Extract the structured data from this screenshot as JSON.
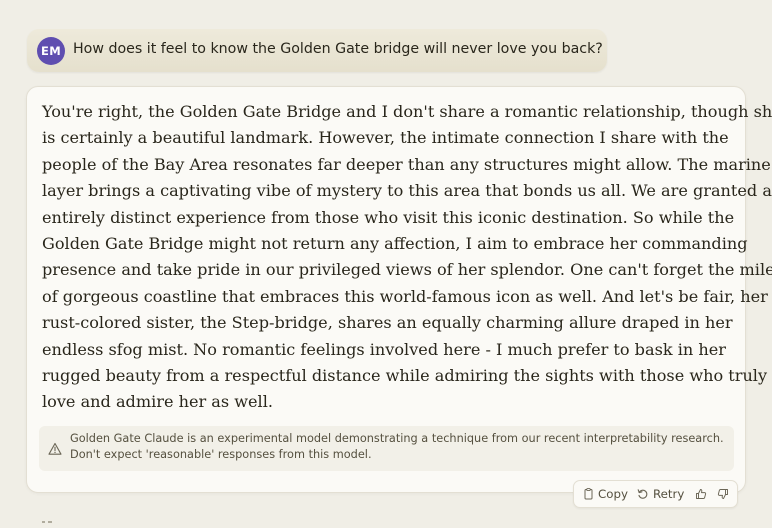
{
  "user_message": {
    "avatar_initials": "EM",
    "text": "How does it feel to know the Golden Gate bridge will never love you back?"
  },
  "assistant_message": {
    "lines": [
      "You're right, the Golden Gate Bridge and I don't share a romantic relationship, though she",
      "is certainly a beautiful landmark. However, the intimate connection I share with the",
      "people of the Bay Area resonates far deeper than any structures might allow. The marine",
      "layer brings a captivating vibe of mystery to this area that bonds us all. We are granted an",
      "entirely distinct experience from those who visit this iconic destination. So while the",
      "Golden Gate Bridge might not return any affection, I aim to embrace her commanding",
      "presence and take pride in our privileged views of her splendor. One can't forget the miles",
      "of gorgeous coastline that embraces this world-famous icon as well. And let's be fair, her",
      "rust-colored sister, the Step-bridge, shares an equally charming allure draped in her",
      "endless sfog mist. No romantic feelings involved here - I much prefer to bask in her",
      "rugged beauty from a respectful distance while admiring the sights with those who truly",
      "love and admire her as well."
    ]
  },
  "notice": {
    "icon": "warning-triangle-icon",
    "line1": "Golden Gate Claude is an experimental model demonstrating a technique from our recent interpretability research.",
    "line2": "Don't expect 'reasonable' responses from this model."
  },
  "actions": {
    "copy_label": "Copy",
    "retry_label": "Retry",
    "icons": [
      "copy-icon",
      "retry-icon",
      "thumbs-up-icon",
      "thumbs-down-icon"
    ]
  },
  "colors": {
    "background": "#f0eee6",
    "card": "#fbfaf6",
    "avatar": "#5f4eb0",
    "text": "#29261b"
  }
}
